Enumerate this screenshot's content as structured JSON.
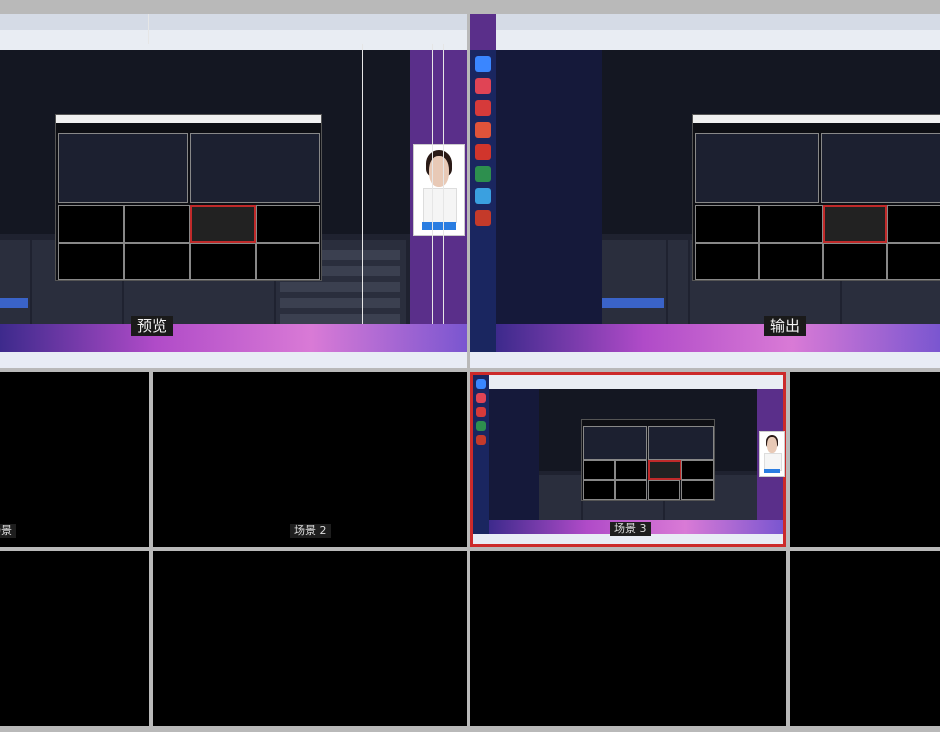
{
  "multiview": {
    "preview_label": "预览",
    "program_label": "输出",
    "scene_labels": {
      "scene_1": "场景",
      "scene_2": "场景 2",
      "scene_3": "场景 3"
    },
    "accent_color": "#cc2a2a"
  }
}
